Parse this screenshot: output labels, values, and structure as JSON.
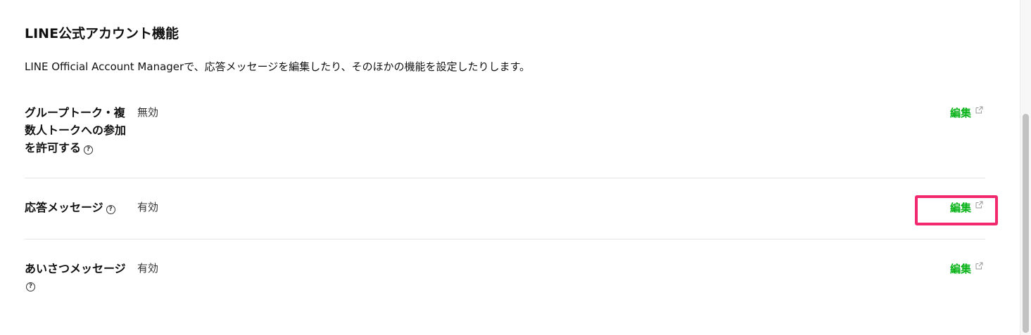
{
  "section": {
    "title": "LINE公式アカウント機能",
    "description": "LINE Official Account Managerで、応答メッセージを編集したり、そのほかの機能を設定したりします。"
  },
  "rows": [
    {
      "label_lines": [
        "グループトーク・複",
        "数人トークへの参加",
        "を許可する"
      ],
      "value": "無効",
      "edit_label": "編集",
      "help_icon": "question-circle-icon",
      "edit_icon": "external-link-icon"
    },
    {
      "label": "応答メッセージ",
      "value": "有効",
      "edit_label": "編集",
      "help_icon": "question-circle-icon",
      "edit_icon": "external-link-icon",
      "highlighted": true
    },
    {
      "label": "あいさつメッセージ",
      "value": "有効",
      "edit_label": "編集",
      "help_icon": "question-circle-icon",
      "edit_icon": "external-link-icon"
    }
  ],
  "help_icon_glyph": "?",
  "colors": {
    "edit_link": "#06b217",
    "highlight": "#f2286e",
    "divider": "#e4e4e4"
  }
}
